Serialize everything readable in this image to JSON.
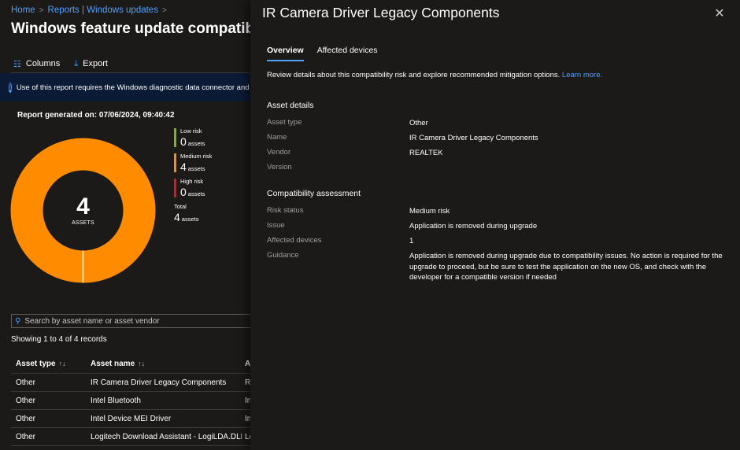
{
  "breadcrumb": [
    {
      "label": "Home"
    },
    {
      "label": "Reports | Windows updates"
    }
  ],
  "page": {
    "title": "Windows feature update compatibility",
    "toolbar": {
      "columns_label": "Columns",
      "export_label": "Export",
      "columns_icon": "columns-icon",
      "export_icon": "download-icon"
    },
    "banner": {
      "icon": "info-icon",
      "text": "Use of this report requires the Windows diagnostic data connector and Windows"
    },
    "report_generated": "Report generated on: 07/06/2024, 09:40:42",
    "summary": {
      "total": "4",
      "total_label": "ASSETS",
      "legend": [
        {
          "label": "Low risk",
          "count": "0",
          "unit": "assets",
          "color": "#7fba00"
        },
        {
          "label": "Medium risk",
          "count": "4",
          "unit": "assets",
          "color": "#ff8c00"
        },
        {
          "label": "High risk",
          "count": "0",
          "unit": "assets",
          "color": "#e81123"
        }
      ],
      "total_item": {
        "label": "Total",
        "count": "4",
        "unit": "assets"
      },
      "donut_segments": [
        {
          "name": "Low risk",
          "value": 0,
          "color": "#7fba00"
        },
        {
          "name": "Medium risk",
          "value": 4,
          "color": "#ff8c00"
        },
        {
          "name": "High risk",
          "value": 0,
          "color": "#e81123"
        }
      ]
    },
    "search": {
      "placeholder": "Search by asset name or asset vendor",
      "value": ""
    },
    "records_text": "Showing 1 to 4 of 4 records",
    "table": {
      "columns": [
        "Asset type",
        "Asset name",
        "Asset vendor"
      ],
      "column_headers_visible": [
        "Asset type",
        "Asset name",
        "A"
      ],
      "rows": [
        {
          "type": "Other",
          "name": "IR Camera Driver Legacy Components",
          "vendor": "REALTEK"
        },
        {
          "type": "Other",
          "name": "Intel Bluetooth",
          "vendor": "In"
        },
        {
          "type": "Other",
          "name": "Intel Device MEI Driver",
          "vendor": "In"
        },
        {
          "type": "Other",
          "name": "Logitech Download Assistant - LogiLDA.DLL",
          "vendor": "Lo"
        }
      ]
    }
  },
  "panel": {
    "title": "IR Camera Driver Legacy Components",
    "close_icon": "close-icon",
    "tabs": [
      {
        "label": "Overview",
        "active": true
      },
      {
        "label": "Affected devices",
        "active": false
      }
    ],
    "description": "Review details about this compatibility risk and explore recommended mitigation options.",
    "learn_more": "Learn more.",
    "asset_details": {
      "title": "Asset details",
      "rows": [
        {
          "key": "Asset type",
          "value": "Other"
        },
        {
          "key": "Name",
          "value": "IR Camera Driver Legacy Components"
        },
        {
          "key": "Vendor",
          "value": "REALTEK"
        },
        {
          "key": "Version",
          "value": ""
        }
      ]
    },
    "compatibility": {
      "title": "Compatibility assessment",
      "rows": [
        {
          "key": "Risk status",
          "value": "Medium risk"
        },
        {
          "key": "Issue",
          "value": "Application is removed during upgrade"
        },
        {
          "key": "Affected devices",
          "value": "1"
        },
        {
          "key": "Guidance",
          "value": "Application is removed during upgrade due to compatibility issues. No action is required for the upgrade to proceed, but be sure to test the application on the new OS, and check with the developer for a compatible version if needed"
        }
      ]
    }
  },
  "colors": {
    "accent": "#4fa0ff",
    "background": "#1b1a19",
    "banner": "#0b1b35",
    "medium_risk": "#ff8c00",
    "low_risk": "#7fba00",
    "high_risk": "#e81123"
  }
}
